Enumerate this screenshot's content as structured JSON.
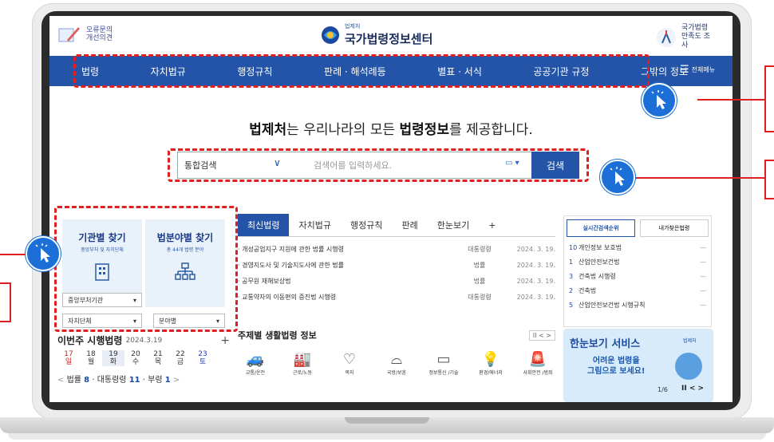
{
  "header": {
    "left_label": "오류문의 개선의견",
    "logo_small": "법제처",
    "logo_big": "국가법령정보센터",
    "right_label": "국가법령 만족도 조사"
  },
  "nav": {
    "items": [
      "법령",
      "자치법규",
      "행정규칙",
      "판례 · 해석례등",
      "별표 · 서식",
      "공공기관 규정",
      "그밖의 정보"
    ],
    "all_menu": "전체메뉴"
  },
  "tagline": {
    "brand": "법제처",
    "mid": "는 우리나라의 모든 ",
    "strong": "법령정보",
    "end": "를 제공합니다."
  },
  "search": {
    "category": "통합검색",
    "placeholder": "검색어를 입력하세요.",
    "button": "검색"
  },
  "finder": {
    "org_title": "기관별 찾기",
    "org_sub": "중앙부처 및 자치단체",
    "field_title": "법분야별 찾기",
    "field_sub": "총 44개 법령 분야",
    "select1": "중앙부처기관",
    "select2": "자치단체",
    "select3": "분야별"
  },
  "tabs": [
    "최신법령",
    "자치법규",
    "행정규칙",
    "판례",
    "한눈보기",
    "+"
  ],
  "laws": [
    {
      "name": "· 개성공업지구 지원에 관한 법률 시행령",
      "kind": "대통령령",
      "date": "2024. 3. 19."
    },
    {
      "name": "· 경영지도사 및 기술지도사에 관한 법률",
      "kind": "법률",
      "date": "2024. 3. 19."
    },
    {
      "name": "· 공무원 재해보상법",
      "kind": "법률",
      "date": "2024. 3. 19."
    },
    {
      "name": "· 교통약자의 이동편의 증진법 시행령",
      "kind": "대통령령",
      "date": "2024. 3. 19."
    }
  ],
  "ranking": {
    "tab1": "실시간검색순위",
    "tab2": "내가찾은법령",
    "items": [
      {
        "n": "10",
        "t": "개인정보 보호법"
      },
      {
        "n": "1",
        "t": "산업안전보건법"
      },
      {
        "n": "3",
        "t": "건축법 시행령"
      },
      {
        "n": "2",
        "t": "건축법"
      },
      {
        "n": "5",
        "t": "산업안전보건법 시행규칙"
      }
    ],
    "mark": "—"
  },
  "week": {
    "title": "이번주 시행법령",
    "date": "2024.3.19",
    "plus": "+",
    "days": [
      {
        "d": "17",
        "w": "일"
      },
      {
        "d": "18",
        "w": "월"
      },
      {
        "d": "19",
        "w": "화"
      },
      {
        "d": "20",
        "w": "수"
      },
      {
        "d": "21",
        "w": "목"
      },
      {
        "d": "22",
        "w": "금"
      },
      {
        "d": "23",
        "w": "토"
      }
    ],
    "stat_law": "법률",
    "stat_law_n": "8",
    "stat_pres": "대통령령",
    "stat_pres_n": "11",
    "stat_min": "부령",
    "stat_min_n": "1"
  },
  "life": {
    "title": "주제별 생활법령 정보",
    "items": [
      "교통/운전",
      "근로/노동",
      "복지",
      "국방/보훈",
      "정보통신 /기술",
      "환경/에너지",
      "사회안전 /범죄"
    ],
    "pager": "II  <  >"
  },
  "banner": {
    "title": "한눈보기 서비스",
    "line1": "어려운 법령을",
    "line2": "그림으로 보세요!",
    "page": "1/6",
    "brand": "법제처"
  },
  "colors": {
    "nav": "#2354a8",
    "highlight": "#e02020",
    "cursor": "#1b6fd6"
  }
}
